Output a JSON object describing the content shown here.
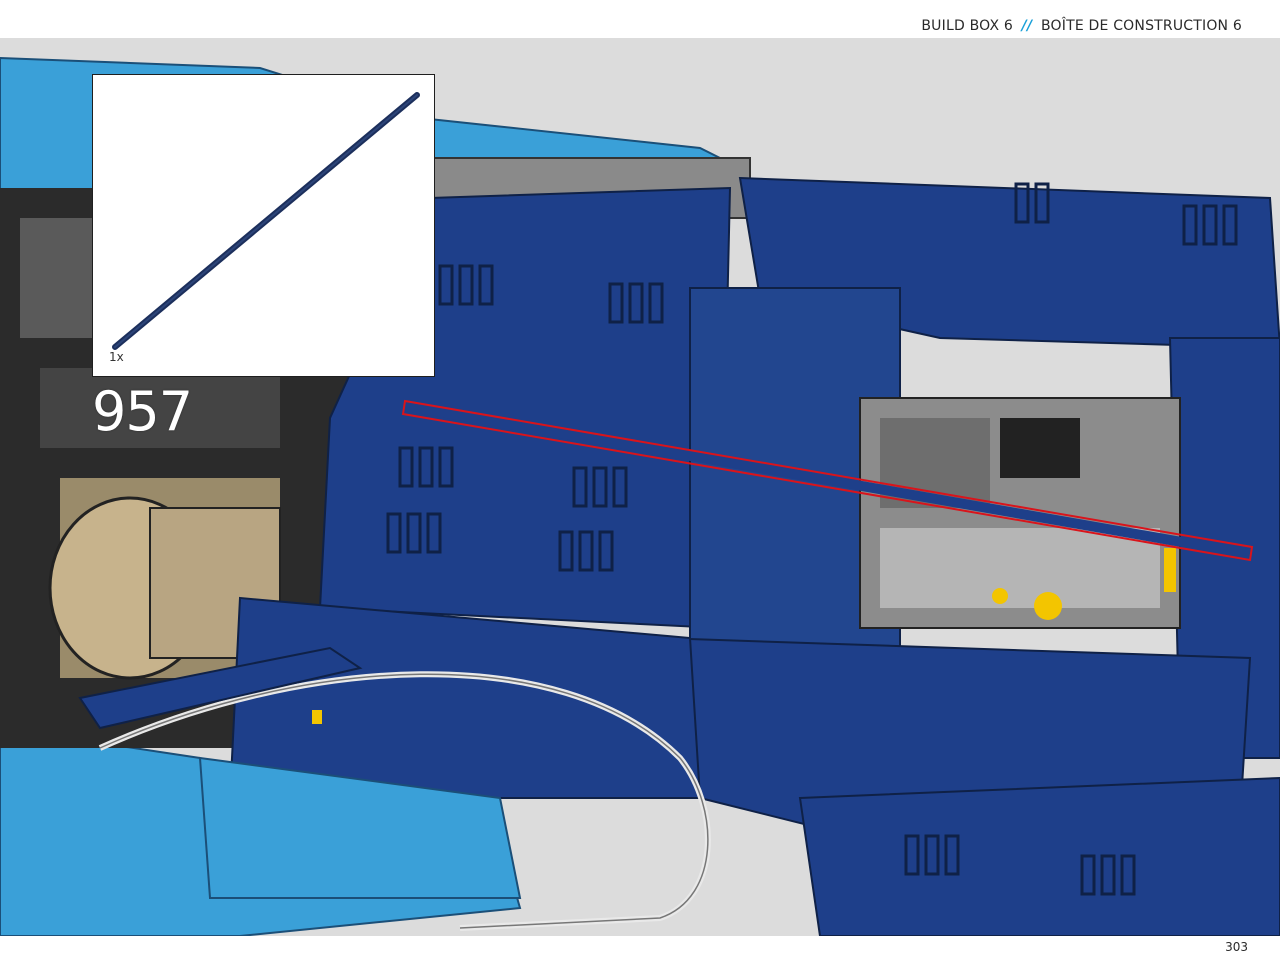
{
  "header": {
    "en": "BUILD BOX 6",
    "separator": "//",
    "fr": "BOÎTE DE CONSTRUCTION 6"
  },
  "callout": {
    "quantity": "1x",
    "part_icon": "dark-blue-axle-icon"
  },
  "step_number": "957",
  "page_number": "303",
  "colors": {
    "dark_blue": "#1e3f8a",
    "medium_blue": "#3aa0d8",
    "highlight_red": "#d9141b",
    "separator_blue": "#1aa0d8",
    "scene_background": "#dcdcdc"
  }
}
